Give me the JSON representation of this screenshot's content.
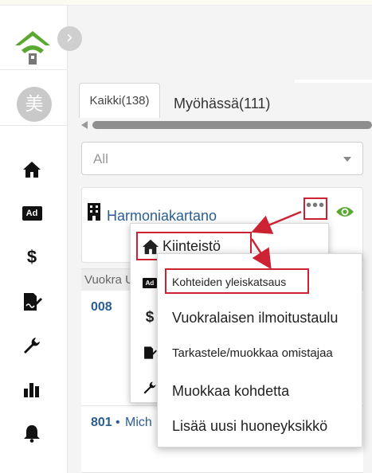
{
  "sidebar": {
    "avatar_text": "美",
    "nav": [
      {
        "icon": "home-icon"
      },
      {
        "icon": "ad-icon",
        "text": "Ad"
      },
      {
        "icon": "dollar-icon",
        "text": "$"
      },
      {
        "icon": "contract-edit-icon"
      },
      {
        "icon": "wrench-icon"
      },
      {
        "icon": "bar-chart-icon"
      },
      {
        "icon": "bell-icon"
      }
    ]
  },
  "collapse_glyph": "›",
  "tabs": [
    {
      "label": "Kaikki(138)",
      "active": true
    },
    {
      "label": "Myöhässä(111)",
      "active": false
    }
  ],
  "filter": {
    "selected": "All"
  },
  "property": {
    "name": "Harmoniakartano",
    "menu_glyph": "•••"
  },
  "table": {
    "header_partial": "Vuokra U"
  },
  "rows": [
    {
      "unit": "008",
      "name": ""
    },
    {
      "unit": "801",
      "separator": "•",
      "name": "Mich"
    }
  ],
  "menu_one": {
    "highlight_label": "Kiinteistö",
    "side_icons": [
      {
        "icon": "ad-icon",
        "text": "Ad"
      },
      {
        "icon": "dollar-icon",
        "text": "$"
      },
      {
        "icon": "contract-edit-icon"
      },
      {
        "icon": "wrench-icon"
      }
    ]
  },
  "menu_two": {
    "items": [
      "Kohteiden yleiskatsaus",
      "Vuokralaisen ilmoitustaulu",
      "Tarkastele/muokkaa omistajaa",
      "Muokkaa kohdetta",
      "Lisää uusi huoneyksikkö"
    ]
  },
  "colors": {
    "accent_red": "#cc2233",
    "link_blue": "#2a5e93",
    "logo_green": "#5aa832",
    "eye_green": "#5aa832"
  }
}
